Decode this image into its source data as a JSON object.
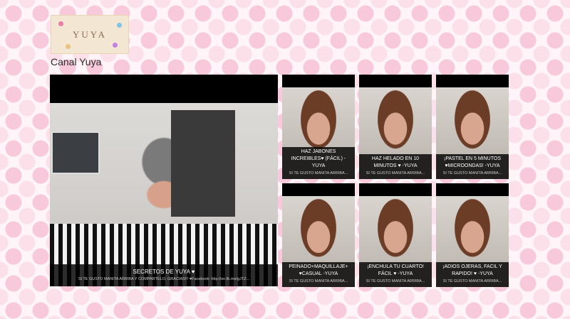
{
  "header": {
    "logo_text": "YUYA",
    "channel_title": "Canal Yuya"
  },
  "featured": {
    "title": "SECRETOS DE YUYA ♥",
    "description": "SI TE GUSTO MANITA ARRIBA Y COMPARTELO, GRACIAS!!! ♥Facebook: http://on.fb.me/gJTZ..."
  },
  "videos": [
    {
      "title": "HAZ JABONES INCREIBLES♥ (FÁCIL) -Yuya",
      "description": "SI TE GUSTO MANITA ARRIBA..."
    },
    {
      "title": "HAZ HELADO EN 10 MINUTOS ♥ -Yuya",
      "description": "SI TE GUSTO MANITA ARRIBA..."
    },
    {
      "title": "¡PASTEL EN 5 MINUTOS ♥MICROONDAS! -Yuya",
      "description": "SI TE GUSTO MANITA ARRIBA..."
    },
    {
      "title": "PEINADO+MAQUILLAJE+ ♥CASUAL -Yuya",
      "description": "SI TE GUSTO MANITA ARRIBA..."
    },
    {
      "title": "¡ENCHULA TU CUARTO! FÁCIL ♥ -Yuya",
      "description": "SI TE GUSTO MANITA ARRIBA..."
    },
    {
      "title": "¡ADIOS OJERAS, FACIL Y RAPIDO! ♥ -Yuya",
      "description": "SI TE GUSTO MANITA ARRIBA..."
    }
  ]
}
